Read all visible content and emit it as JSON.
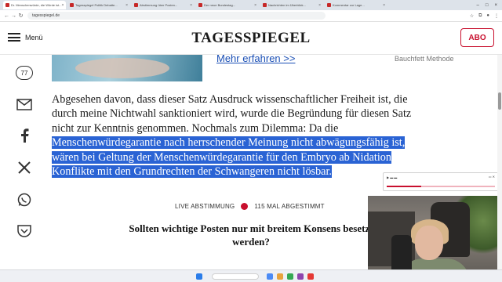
{
  "browser": {
    "tabs": [
      {
        "label": "Dr. Menschenwürde, die Würde ist..."
      },
      {
        "label": "Tagesspiegel Politik Debatte..."
      },
      {
        "label": "Abstimmung über Posten..."
      },
      {
        "label": "Der neue Bundestag..."
      },
      {
        "label": "Nachrichten im Überblick..."
      },
      {
        "label": "Kommentar zur Lage..."
      }
    ],
    "url": "tagesspiegel.de"
  },
  "header": {
    "menu_label": "Menü",
    "logo": "TAGESSPIEGEL",
    "abo_label": "ABO"
  },
  "ad": {
    "link_text": "Mehr erfahren >>",
    "sponsor_text": "Bauchfett Methode"
  },
  "share": {
    "comment_count": "77"
  },
  "article": {
    "lines": [
      "Abgesehen davon, dass dieser Satz Ausdruck wissenschaftlicher Freiheit ist, die",
      "durch meine Nichtwahl sanktioniert wird, wurde die Begründung für diesen Satz",
      "nicht zur Kenntnis genommen. Nochmals zum Dilemma: Da die"
    ],
    "highlighted_lines": [
      "Menschenwürdegarantie nach herrschender Meinung nicht abwägungsfähig ist,",
      "wären bei Geltung der Menschenwürdegarantie für den Embryo ab Nidation",
      "Konflikte mit den Grundrechten der Schwangeren nicht lösbar."
    ]
  },
  "poll": {
    "live_label": "LIVE ABSTIMMUNG",
    "votes_label": "115 MAL ABGESTIMMT",
    "question": "Sollten wichtige Posten nur mit breitem Konsens besetzt werden?"
  },
  "mini_player": {
    "progress": 0.32
  },
  "colors": {
    "brand_red": "#c8102e",
    "highlight": "#2a63d4",
    "link": "#1a4fb5"
  }
}
